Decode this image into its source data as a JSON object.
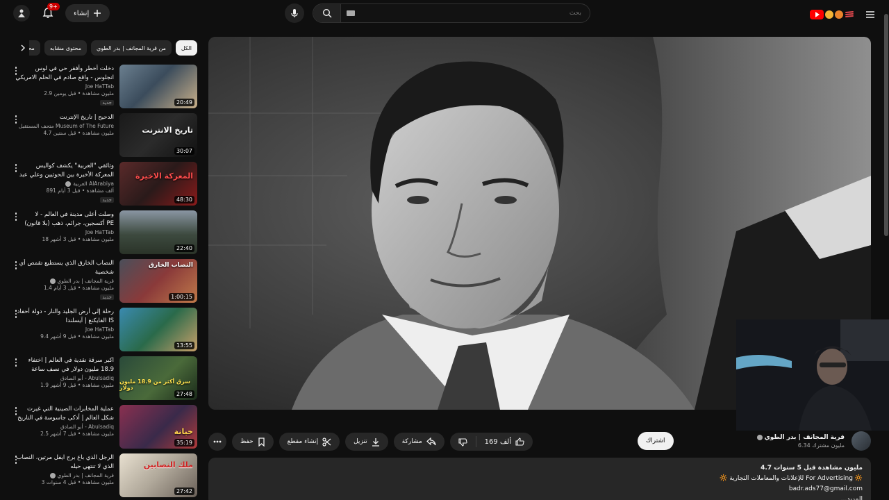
{
  "topbar": {
    "create_label": "إنشاء",
    "notification_count": "9+",
    "search_placeholder": "بحث"
  },
  "video": {
    "like_count": "169 ألف",
    "share_label": "مشاركة",
    "download_label": "تنزيل",
    "clip_label": "إنشاء مقطع",
    "save_label": "حفظ"
  },
  "channel": {
    "name": "قرية المجانف | بدر الطوي",
    "subscribers": "6.34 مليون مشترك",
    "subscribe_label": "اشتراك"
  },
  "description": {
    "meta": "4.7 مليون مشاهدة  قبل 5 سنوات",
    "line1": "🔆 للإعلانات والمعاملات التجارية For Advertising 🔆",
    "line2": "badr.ads77@gmail.com",
    "more": "...المزيد"
  },
  "chips": [
    {
      "label": "الكل"
    },
    {
      "label": "من قرية المجانف | بدر الطوي"
    },
    {
      "label": "محتوى مشابه"
    },
    {
      "label": "محتوى"
    }
  ],
  "recommendations": [
    {
      "title": "دخلت أخطر وأفقر حي في لوس انجلوس - واقع صادم في الحلم الامريكي US",
      "channel": "Joe HaTTab",
      "stats": "2.9 مليون مشاهدة • قبل يومين",
      "badge": "جديد",
      "duration": "20:49",
      "thumb_text": ""
    },
    {
      "title": "الدحيح | تاريخ الإنترنت",
      "channel": "متحف المستقبل Museum of The Future",
      "stats": "4.7 مليون مشاهدة • قبل سنتين",
      "badge": "",
      "duration": "30:07",
      "thumb_text": "تاريخ الانترنت"
    },
    {
      "title": "وثائقي \"العربية\" يكشف كواليس المعركة الأخيرة بين الحوثيين وعلي عبد الله صالح",
      "channel": "العربية AlArabiya",
      "stats": "891 ألف مشاهدة • قبل 3 أيام",
      "badge": "جديد",
      "duration": "48:30",
      "thumb_text": "المعركة الاخيرة"
    },
    {
      "title": "وصلت أعلى مدينة في العالم - لا أكسجين، جرائم، ذهب (بلا قانون) PE",
      "channel": "Joe HaTTab",
      "stats": "18 مليون مشاهدة • قبل 3 أشهر",
      "badge": "",
      "duration": "22:40",
      "thumb_text": ""
    },
    {
      "title": "النصاب الخارق الذي يستطيع تقمص أي شخصية",
      "channel": "قرية المجانف | بدر الطوي",
      "stats": "1.4 مليون مشاهدة • قبل 3 أيام",
      "badge": "جديد",
      "duration": "1:00:15",
      "thumb_text": "النصاب الخارق"
    },
    {
      "title": "رحلة إلى أرض الجليد والنار - دولة أحفاد الفايكنغ | آيسلندا IS",
      "channel": "Joe HaTTab",
      "stats": "9.4 مليون مشاهدة • قبل 9 أشهر",
      "badge": "",
      "duration": "13:55",
      "thumb_text": ""
    },
    {
      "title": "اكبر سرقة نقدية في العالم | اختفاء 18.9 مليون دولار في نصف ساعة",
      "channel": "أبو الصادق - Abulsadiq",
      "stats": "1.9 مليون مشاهدة • قبل 9 أشهر",
      "badge": "",
      "duration": "27:48",
      "thumb_text": "سرق أكثر من 18.9 مليون دولار"
    },
    {
      "title": "عملية المخابرات الصينية التي غيرت شكل العالم | أذكى جاسوسة في التاريخ",
      "channel": "أبو الصادق - Abulsadiq",
      "stats": "2.5 مليون مشاهدة • قبل 7 أشهر",
      "badge": "",
      "duration": "35:19",
      "thumb_text": "خيانة"
    },
    {
      "title": "الرجل الذي باع برج ايفل مرتين، النصاب الذي لا تنتهي حيله",
      "channel": "قرية المجانف | بدر الطوي",
      "stats": "3 مليون مشاهدة • قبل 4 سنوات",
      "badge": "",
      "duration": "27:42",
      "thumb_text": "ملك النصابين"
    }
  ]
}
